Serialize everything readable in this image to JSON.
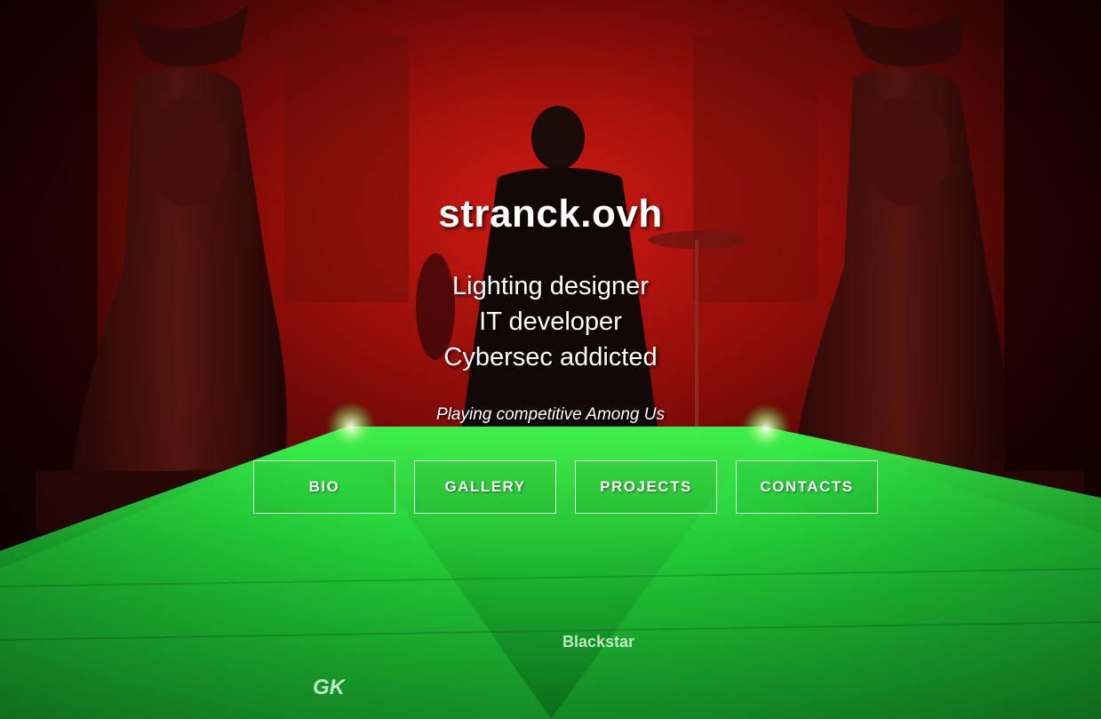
{
  "site": {
    "title": "stranck.ovh",
    "roles": [
      "Lighting designer",
      "IT developer",
      "Cybersec addicted"
    ],
    "status": "Playing competitive Among Us"
  },
  "nav": {
    "bio": "BIO",
    "gallery": "GALLERY",
    "projects": "PROJECTS",
    "contacts": "CONTACTS"
  },
  "photo": {
    "amp_brand": "Blackstar",
    "amp_brand_2": "GK"
  },
  "colors": {
    "stage_red": "#b01010",
    "laser_green": "#22e03a"
  }
}
